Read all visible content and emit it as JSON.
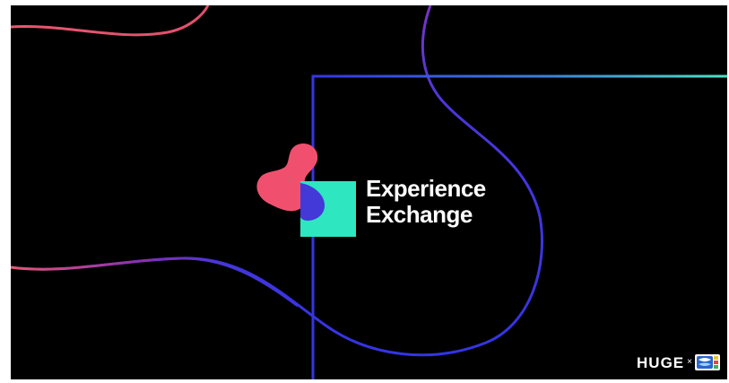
{
  "brand": {
    "line1": "Experience",
    "line2": "Exchange"
  },
  "partners": {
    "agency": "HUGE",
    "separator": "×",
    "partner_logo": "partner-badge-logo"
  },
  "colors": {
    "background": "#000000",
    "coral": "#f0506e",
    "mint": "#2ee6bf",
    "indigo": "#4338d8",
    "frame_line": "#3535e0"
  }
}
